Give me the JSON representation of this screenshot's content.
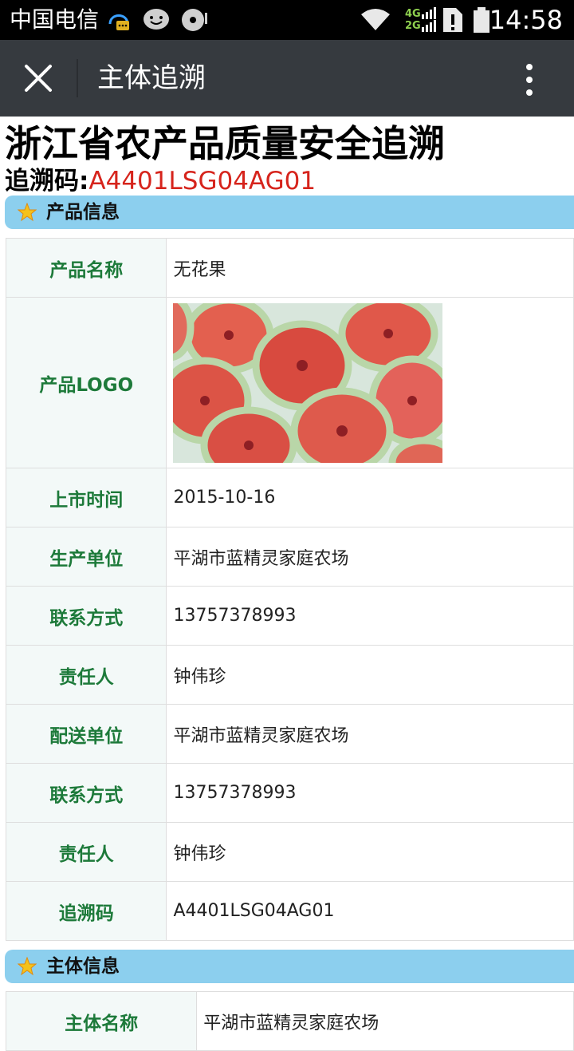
{
  "status_bar": {
    "carrier": "中国电信",
    "network_top": "4G",
    "network_bottom": "2G",
    "time": "14:58"
  },
  "app_bar": {
    "title": "主体追溯"
  },
  "page": {
    "title": "浙江省农产品质量安全追溯",
    "trace_label": "追溯码:",
    "trace_code": "A4401LSG04AG01"
  },
  "sections": [
    {
      "title": "产品信息",
      "rows": [
        {
          "key": "产品名称",
          "value": "无花果"
        },
        {
          "key": "产品LOGO",
          "value": "",
          "image": "fig-halves-photo"
        },
        {
          "key": "上市时间",
          "value": "2015-10-16"
        },
        {
          "key": "生产单位",
          "value": "平湖市蓝精灵家庭农场"
        },
        {
          "key": "联系方式",
          "value": "13757378993"
        },
        {
          "key": "责任人",
          "value": "钟伟珍"
        },
        {
          "key": "配送单位",
          "value": "平湖市蓝精灵家庭农场"
        },
        {
          "key": "联系方式",
          "value": "13757378993"
        },
        {
          "key": "责任人",
          "value": "钟伟珍"
        },
        {
          "key": "追溯码",
          "value": "A4401LSG04AG01"
        }
      ]
    },
    {
      "title": "主体信息",
      "rows": [
        {
          "key": "主体名称",
          "value": "平湖市蓝精灵家庭农场"
        }
      ]
    }
  ],
  "colors": {
    "status_bar": "#000000",
    "app_bar": "#363a3f",
    "section_bar": "#8ccfee",
    "key_text": "#1d7a3a",
    "trace_code": "#d6241c"
  }
}
